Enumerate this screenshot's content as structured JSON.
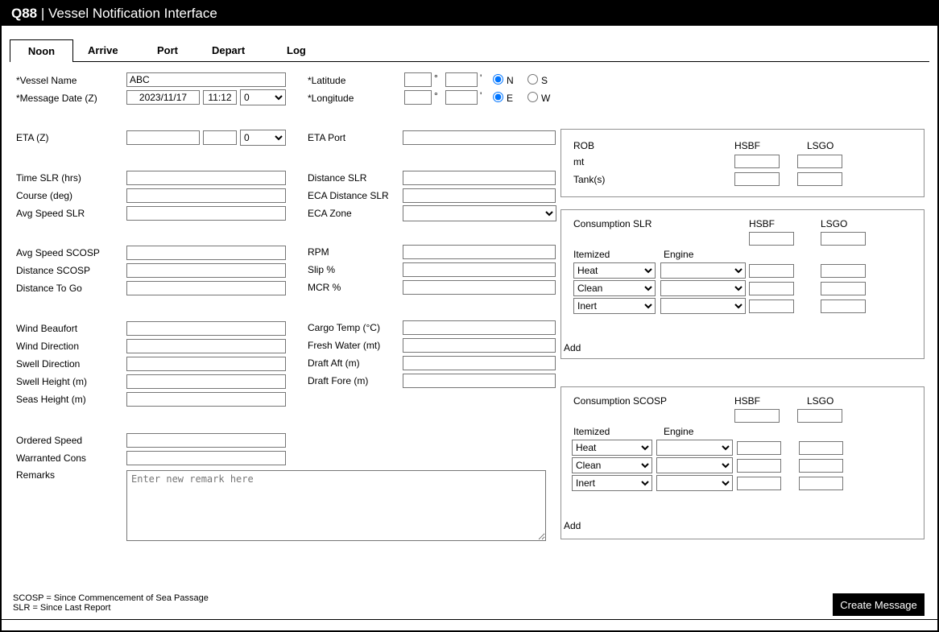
{
  "header": {
    "brand": "Q88",
    "separator": " | ",
    "title": "Vessel Notification Interface"
  },
  "tabs": {
    "noon": "Noon",
    "arrive": "Arrive",
    "port": "Port",
    "depart": "Depart",
    "log": "Log",
    "active": "Noon"
  },
  "form": {
    "vessel_name": {
      "label": "*Vessel Name",
      "value": "ABC"
    },
    "message_date": {
      "label": "*Message Date (Z)",
      "date": "2023/11/17",
      "time": "11:12",
      "offset": "0"
    },
    "eta": {
      "label": "ETA (Z)",
      "date": "",
      "time": "",
      "offset": "0"
    },
    "latitude": {
      "label": "*Latitude",
      "degrees": "",
      "minutes": "",
      "deg_mark": "°",
      "min_mark": "'",
      "north": "N",
      "south": "S",
      "selected": "N"
    },
    "longitude": {
      "label": "*Longitude",
      "degrees": "",
      "minutes": "",
      "deg_mark": "°",
      "min_mark": "'",
      "east": "E",
      "west": "W",
      "selected": "E"
    },
    "eta_port": {
      "label": "ETA Port",
      "value": ""
    },
    "time_slr": {
      "label": "Time SLR (hrs)",
      "value": ""
    },
    "course": {
      "label": "Course (deg)",
      "value": ""
    },
    "avg_speed_slr": {
      "label": "Avg Speed SLR",
      "value": ""
    },
    "distance_slr": {
      "label": "Distance SLR",
      "value": ""
    },
    "eca_distance_slr": {
      "label": "ECA Distance SLR",
      "value": ""
    },
    "eca_zone": {
      "label": "ECA Zone",
      "value": ""
    },
    "avg_speed_scosp": {
      "label": "Avg Speed SCOSP",
      "value": ""
    },
    "distance_scosp": {
      "label": "Distance SCOSP",
      "value": ""
    },
    "distance_to_go": {
      "label": "Distance To Go",
      "value": ""
    },
    "rpm": {
      "label": "RPM",
      "value": ""
    },
    "slip": {
      "label": "Slip %",
      "value": ""
    },
    "mcr": {
      "label": "MCR %",
      "value": ""
    },
    "wind_beaufort": {
      "label": "Wind Beaufort",
      "value": ""
    },
    "wind_direction": {
      "label": "Wind Direction",
      "value": ""
    },
    "swell_direction": {
      "label": "Swell Direction",
      "value": ""
    },
    "swell_height": {
      "label": "Swell Height (m)",
      "value": ""
    },
    "seas_height": {
      "label": "Seas Height (m)",
      "value": ""
    },
    "cargo_temp": {
      "label": "Cargo Temp (°C)",
      "value": ""
    },
    "fresh_water": {
      "label": "Fresh Water (mt)",
      "value": ""
    },
    "draft_aft": {
      "label": "Draft Aft (m)",
      "value": ""
    },
    "draft_fore": {
      "label": "Draft Fore (m)",
      "value": ""
    },
    "ordered_speed": {
      "label": "Ordered Speed",
      "value": ""
    },
    "warranted_cons": {
      "label": "Warranted Cons",
      "value": ""
    },
    "remarks": {
      "label": "Remarks",
      "placeholder": "Enter new remark here",
      "value": ""
    }
  },
  "rob": {
    "title": "ROB",
    "hsbf": "HSBF",
    "lsgo": "LSGO",
    "mt_label": "mt",
    "tanks_label": "Tank(s)"
  },
  "consumption_slr": {
    "title": "Consumption SLR",
    "hsbf": "HSBF",
    "lsgo": "LSGO",
    "itemized": "Itemized",
    "engine": "Engine",
    "add": "Add",
    "rows": [
      {
        "itemized": "Heat"
      },
      {
        "itemized": "Clean"
      },
      {
        "itemized": "Inert"
      }
    ]
  },
  "consumption_scosp": {
    "title": "Consumption SCOSP",
    "hsbf": "HSBF",
    "lsgo": "LSGO",
    "itemized": "Itemized",
    "engine": "Engine",
    "add": "Add",
    "rows": [
      {
        "itemized": "Heat"
      },
      {
        "itemized": "Clean"
      },
      {
        "itemized": "Inert"
      }
    ]
  },
  "footer": {
    "scosp_note": "SCOSP = Since Commencement of Sea Passage",
    "slr_note": "SLR = Since Last Report",
    "create_button": "Create Message"
  }
}
